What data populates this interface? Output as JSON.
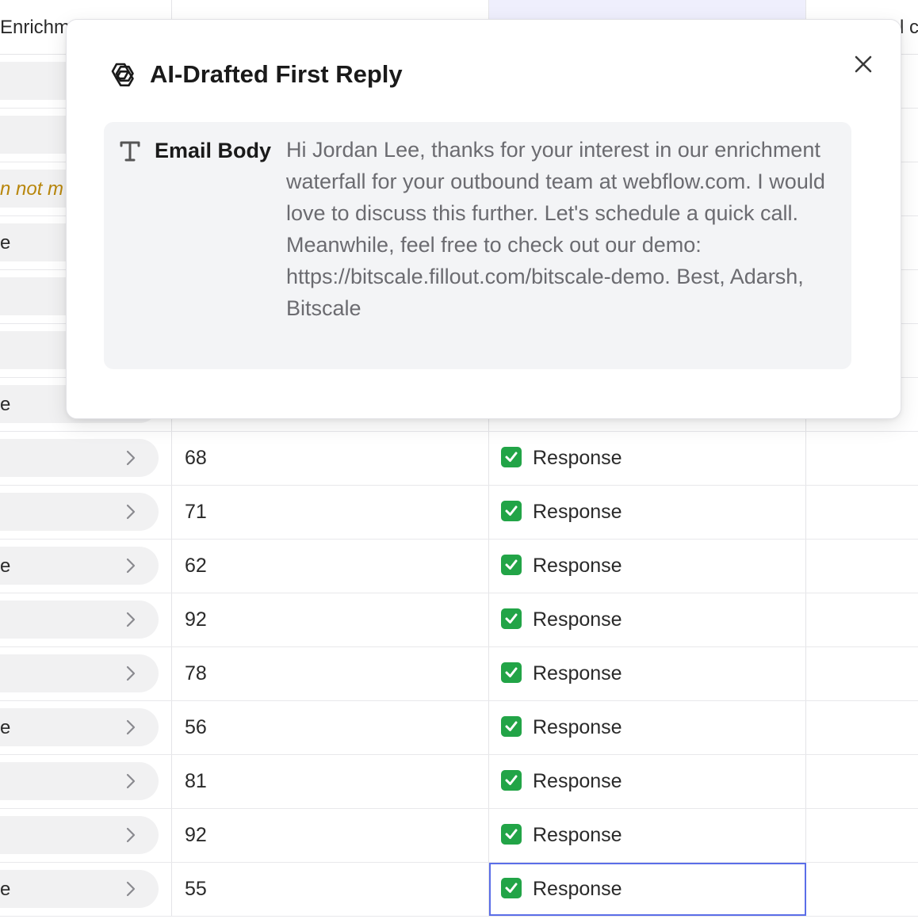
{
  "table": {
    "columns": [
      {
        "label": "Enrichm"
      },
      {
        "label": ""
      },
      {
        "label": ""
      },
      {
        "label": "l c"
      }
    ],
    "rows": [
      {
        "col1": "",
        "col1_warn": false,
        "has_chevron": false,
        "col2": "",
        "col3": ""
      },
      {
        "col1": "",
        "col1_warn": false,
        "has_chevron": false,
        "col2": "",
        "col3": ""
      },
      {
        "col1": "n not m",
        "col1_warn": true,
        "has_chevron": false,
        "col2": "",
        "col3": ""
      },
      {
        "col1": "e",
        "col1_warn": false,
        "has_chevron": false,
        "col2": "",
        "col3": ""
      },
      {
        "col1": "",
        "col1_warn": false,
        "has_chevron": false,
        "col2": "",
        "col3": ""
      },
      {
        "col1": "",
        "col1_warn": false,
        "has_chevron": false,
        "col2": "",
        "col3": ""
      },
      {
        "col1": "e",
        "col1_warn": false,
        "has_chevron": false,
        "col2": "",
        "col3": ""
      },
      {
        "col1": "",
        "col1_warn": false,
        "has_chevron": true,
        "col2": "68",
        "col3": "Response"
      },
      {
        "col1": "",
        "col1_warn": false,
        "has_chevron": true,
        "col2": "71",
        "col3": "Response"
      },
      {
        "col1": "e",
        "col1_warn": false,
        "has_chevron": true,
        "col2": "62",
        "col3": "Response"
      },
      {
        "col1": "",
        "col1_warn": false,
        "has_chevron": true,
        "col2": "92",
        "col3": "Response"
      },
      {
        "col1": "",
        "col1_warn": false,
        "has_chevron": true,
        "col2": "78",
        "col3": "Response"
      },
      {
        "col1": "e",
        "col1_warn": false,
        "has_chevron": true,
        "col2": "56",
        "col3": "Response"
      },
      {
        "col1": "",
        "col1_warn": false,
        "has_chevron": true,
        "col2": "81",
        "col3": "Response"
      },
      {
        "col1": "",
        "col1_warn": false,
        "has_chevron": true,
        "col2": "92",
        "col3": "Response"
      },
      {
        "col1": "e",
        "col1_warn": false,
        "has_chevron": true,
        "col2": "55",
        "col3": "Response",
        "selected": true
      }
    ]
  },
  "modal": {
    "title": "AI-Drafted First Reply",
    "title_icon": "openai-logo-icon",
    "close_icon": "close-icon",
    "field": {
      "type_icon": "text-type-icon",
      "label": "Email Body",
      "value": "Hi Jordan Lee, thanks for your interest in our enrichment waterfall for your outbound team at webflow.com. I would love to discuss this further. Let's schedule a quick call. Meanwhile, feel free to check out our demo: https://bitscale.fillout.com/bitscale-demo. Best, Adarsh, Bitscale"
    }
  },
  "colors": {
    "accent": "#5b6ee8",
    "selected_column_bg": "#efeffd",
    "check_green": "#22a447",
    "warning_text": "#b8860b",
    "field_bg": "#f3f4f6"
  }
}
